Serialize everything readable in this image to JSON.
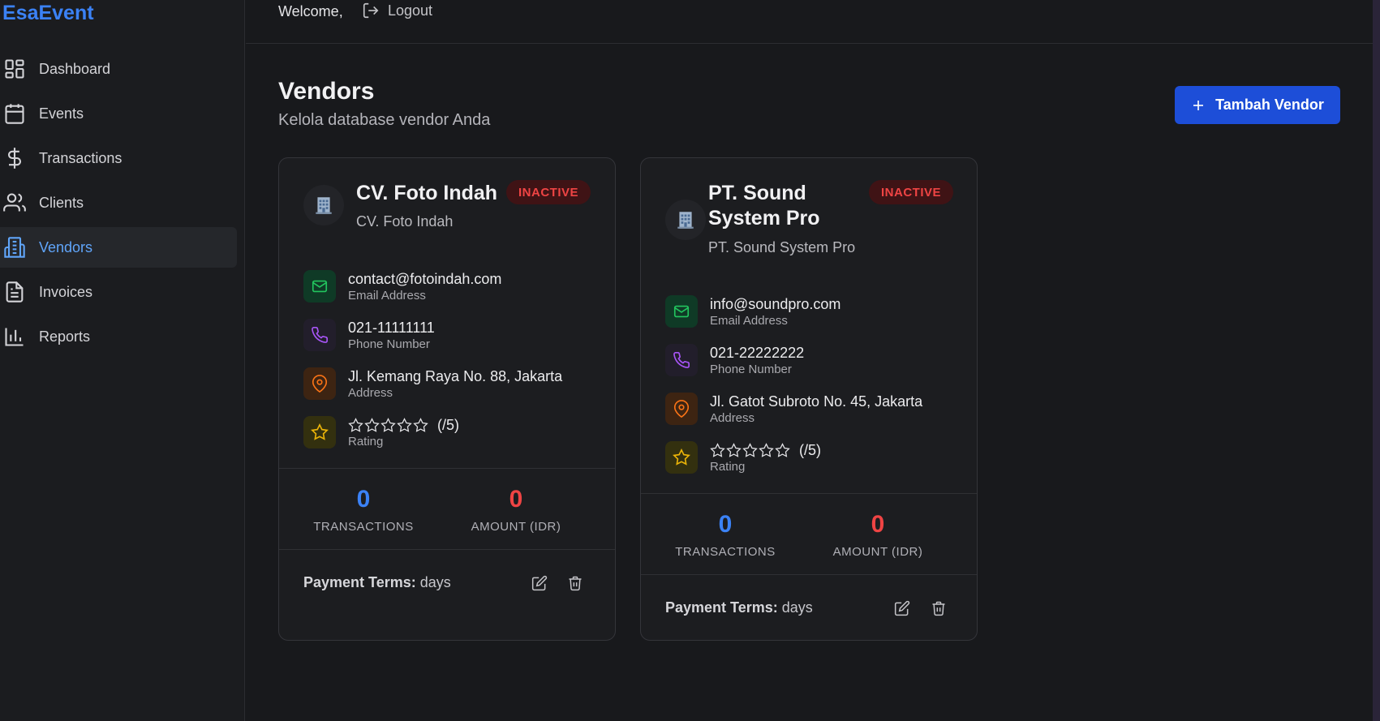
{
  "app": {
    "brand": "EsaEvent"
  },
  "sidebar": {
    "items": [
      {
        "label": "Dashboard",
        "icon": "layout-grid-icon"
      },
      {
        "label": "Events",
        "icon": "calendar-icon"
      },
      {
        "label": "Transactions",
        "icon": "dollar-icon"
      },
      {
        "label": "Clients",
        "icon": "users-icon"
      },
      {
        "label": "Vendors",
        "icon": "building-icon",
        "active": true
      },
      {
        "label": "Invoices",
        "icon": "file-text-icon"
      },
      {
        "label": "Reports",
        "icon": "bar-chart-icon"
      }
    ]
  },
  "topbar": {
    "welcome": "Welcome,",
    "logout": "Logout"
  },
  "page": {
    "title": "Vendors",
    "subtitle": "Kelola database vendor Anda",
    "add_button": "Tambah Vendor"
  },
  "vendors": [
    {
      "name": "CV. Foto Indah",
      "company": "CV. Foto Indah",
      "status": "INACTIVE",
      "email": "contact@fotoindah.com",
      "email_label": "Email Address",
      "phone": "021-11111111",
      "phone_label": "Phone Number",
      "address": "Jl. Kemang Raya No. 88, Jakarta",
      "address_label": "Address",
      "rating_text": "(/5)",
      "rating_stars": 0,
      "rating_label": "Rating",
      "transactions": "0",
      "transactions_label": "TRANSACTIONS",
      "amount": "0",
      "amount_label": "AMOUNT (IDR)",
      "terms_label": "Payment Terms:",
      "terms_value": "days"
    },
    {
      "name": "PT. Sound System Pro",
      "company": "PT. Sound System Pro",
      "status": "INACTIVE",
      "email": "info@soundpro.com",
      "email_label": "Email Address",
      "phone": "021-22222222",
      "phone_label": "Phone Number",
      "address": "Jl. Gatot Subroto No. 45, Jakarta",
      "address_label": "Address",
      "rating_text": "(/5)",
      "rating_stars": 0,
      "rating_label": "Rating",
      "transactions": "0",
      "transactions_label": "TRANSACTIONS",
      "amount": "0",
      "amount_label": "AMOUNT (IDR)",
      "terms_label": "Payment Terms:",
      "terms_value": "days"
    }
  ],
  "colors": {
    "accent": "#3b82f6",
    "button": "#1d4ed8",
    "inactive": "#ef4444"
  }
}
